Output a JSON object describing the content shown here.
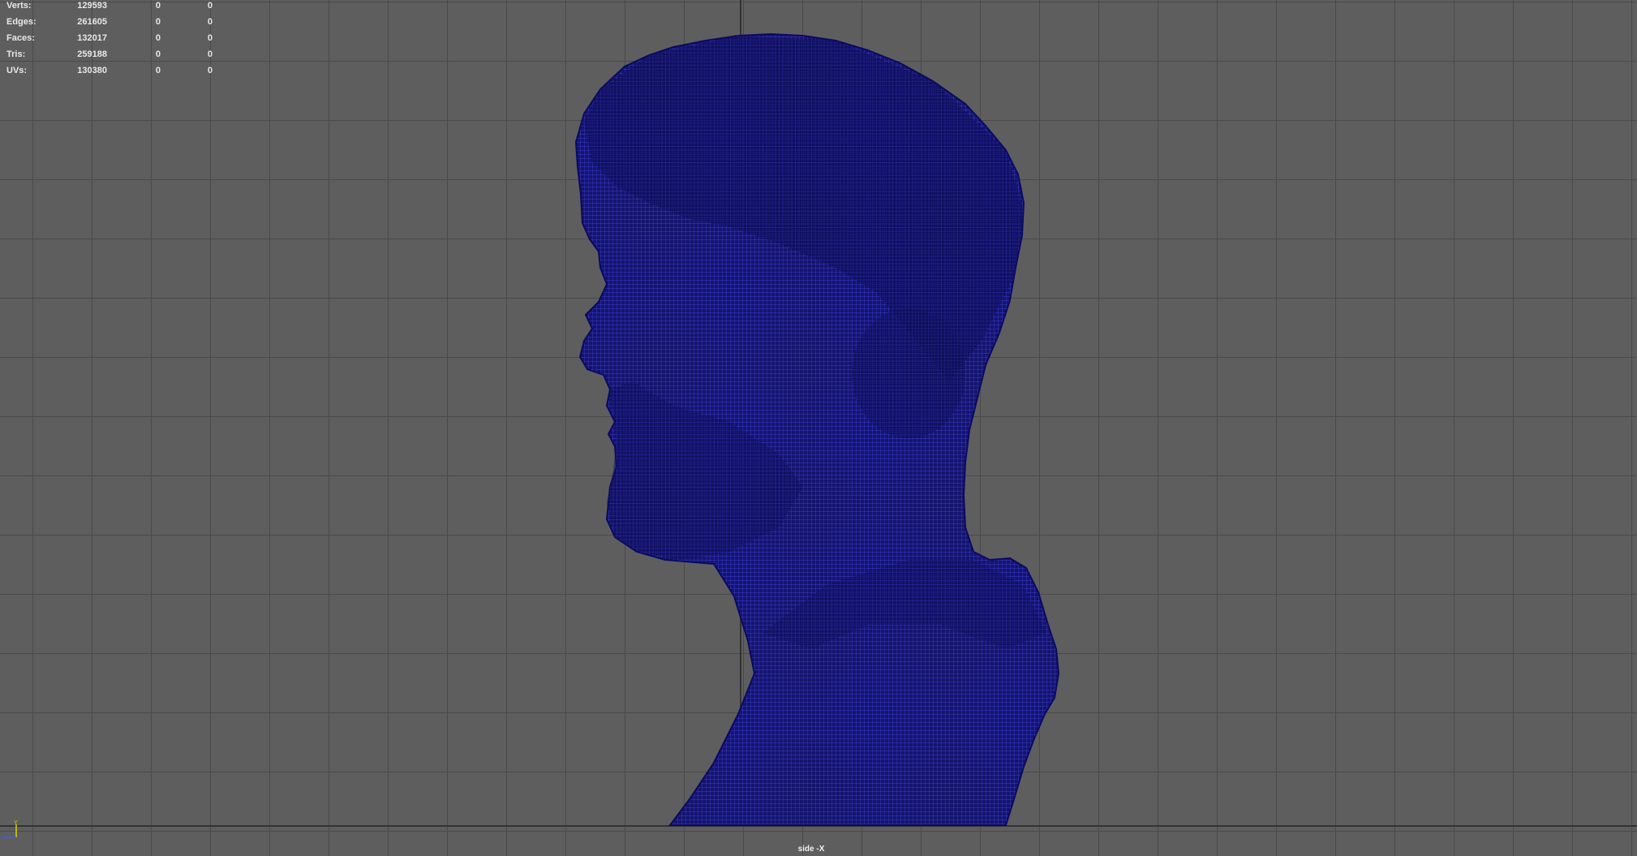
{
  "viewport": {
    "background_color": "#5e5e5e",
    "grid_color": "#4a4a4a",
    "mesh_color": "#1a1a8c",
    "camera_label": "side -X"
  },
  "hud": {
    "rows": [
      {
        "label": "Verts:",
        "v1": "129593",
        "v2": "0",
        "v3": "0"
      },
      {
        "label": "Edges:",
        "v1": "261605",
        "v2": "0",
        "v3": "0"
      },
      {
        "label": "Faces:",
        "v1": "132017",
        "v2": "0",
        "v3": "0"
      },
      {
        "label": "Tris:",
        "v1": "259188",
        "v2": "0",
        "v3": "0"
      },
      {
        "label": "UVs:",
        "v1": "130380",
        "v2": "0",
        "v3": "0"
      }
    ]
  },
  "gizmo": {
    "icon": "axis-gizmo-icon",
    "y_color": "#d6d600",
    "z_color": "#3a5aff"
  },
  "model": {
    "icon": "bust-wireframe-mesh"
  }
}
